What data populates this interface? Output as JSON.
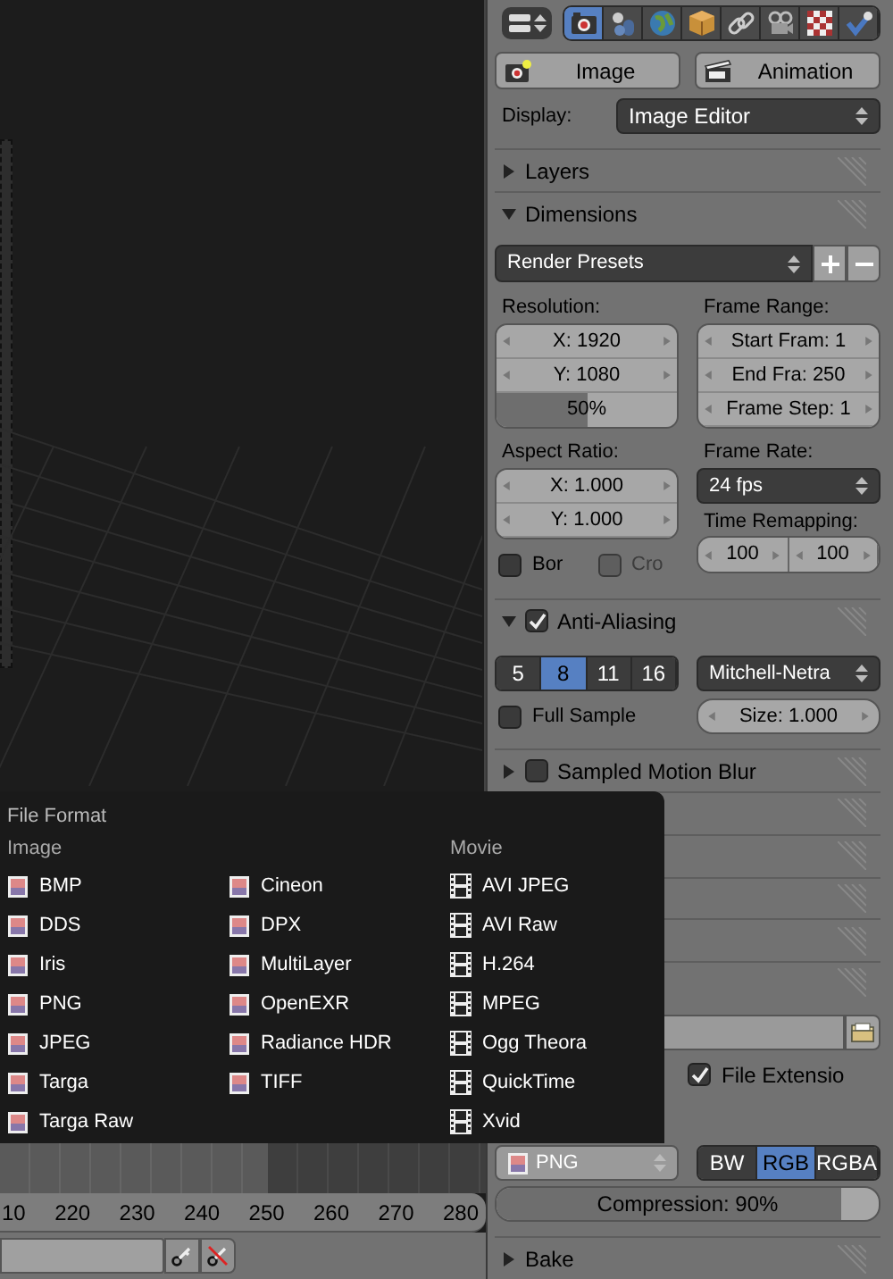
{
  "properties": {
    "tabs": [
      {
        "selected": true
      },
      {
        "selected": false
      },
      {
        "selected": false
      },
      {
        "selected": false
      },
      {
        "selected": false
      },
      {
        "selected": false
      },
      {
        "selected": false
      },
      {
        "selected": false
      }
    ],
    "render_buttons": [
      "Image",
      "Animation"
    ],
    "display": {
      "label": "Display:",
      "value": "Image Editor"
    },
    "layers": {
      "title": "Layers",
      "expanded": false
    },
    "dimensions": {
      "title": "Dimensions",
      "expanded": true,
      "presets": "Render Presets"
    },
    "resolution": {
      "label": "Resolution:",
      "fields": [
        "X: 1920",
        "Y: 1080"
      ],
      "percent": {
        "text": "50%",
        "level": 0.5
      }
    },
    "frame_range": {
      "label": "Frame Range:",
      "fields": [
        "Start Fram: 1",
        "End Fra: 250",
        "Frame Step: 1"
      ]
    },
    "aspect_ratio": {
      "label": "Aspect Ratio:",
      "fields": [
        "X: 1.000",
        "Y: 1.000"
      ]
    },
    "frame_rate": {
      "label": "Frame Rate:",
      "value": "24 fps"
    },
    "border": [
      {
        "label": "Bor",
        "checked": false,
        "disabled": false
      },
      {
        "label": "Cro",
        "checked": false,
        "disabled": true
      }
    ],
    "time_remapping": {
      "label": "Time Remapping:",
      "fields": [
        "100",
        "100"
      ]
    },
    "anti_aliasing": {
      "title": "Anti-Aliasing",
      "expanded": true,
      "checked": true,
      "samples": [
        {
          "label": "5",
          "selected": false
        },
        {
          "label": "8",
          "selected": true
        },
        {
          "label": "11",
          "selected": false
        },
        {
          "label": "16",
          "selected": false
        }
      ],
      "filter": "Mitchell-Netra",
      "full_sample": {
        "label": "Full Sample",
        "checked": false
      },
      "size": "Size: 1.000"
    },
    "motion_blur": {
      "title": "Sampled Motion Blur",
      "expanded": false,
      "checked": false
    },
    "output": {
      "file_extensions": {
        "label": "File Extensio",
        "checked": true
      },
      "format": "PNG",
      "color_modes": [
        {
          "label": "BW",
          "selected": false
        },
        {
          "label": "RGB",
          "selected": true
        },
        {
          "label": "RGBA",
          "selected": false
        }
      ],
      "compression": {
        "text": "Compression: 90%",
        "level": 0.9
      }
    },
    "bake": {
      "title": "Bake",
      "expanded": false
    }
  },
  "file_format_menu": {
    "title": "File Format",
    "columns": [
      {
        "kind": "image",
        "heading": "Image",
        "items": [
          "BMP",
          "DDS",
          "Iris",
          "PNG",
          "JPEG",
          "Targa",
          "Targa Raw"
        ]
      },
      {
        "kind": "image",
        "items": [
          "Cineon",
          "DPX",
          "MultiLayer",
          "OpenEXR",
          "Radiance HDR",
          "TIFF"
        ]
      },
      {
        "kind": "movie",
        "heading": "Movie",
        "items": [
          "AVI JPEG",
          "AVI Raw",
          "H.264",
          "MPEG",
          "Ogg Theora",
          "QuickTime",
          "Xvid"
        ]
      }
    ]
  },
  "timeline": {
    "ticks": [
      "10",
      "220",
      "230",
      "240",
      "250",
      "260",
      "270",
      "280"
    ]
  }
}
